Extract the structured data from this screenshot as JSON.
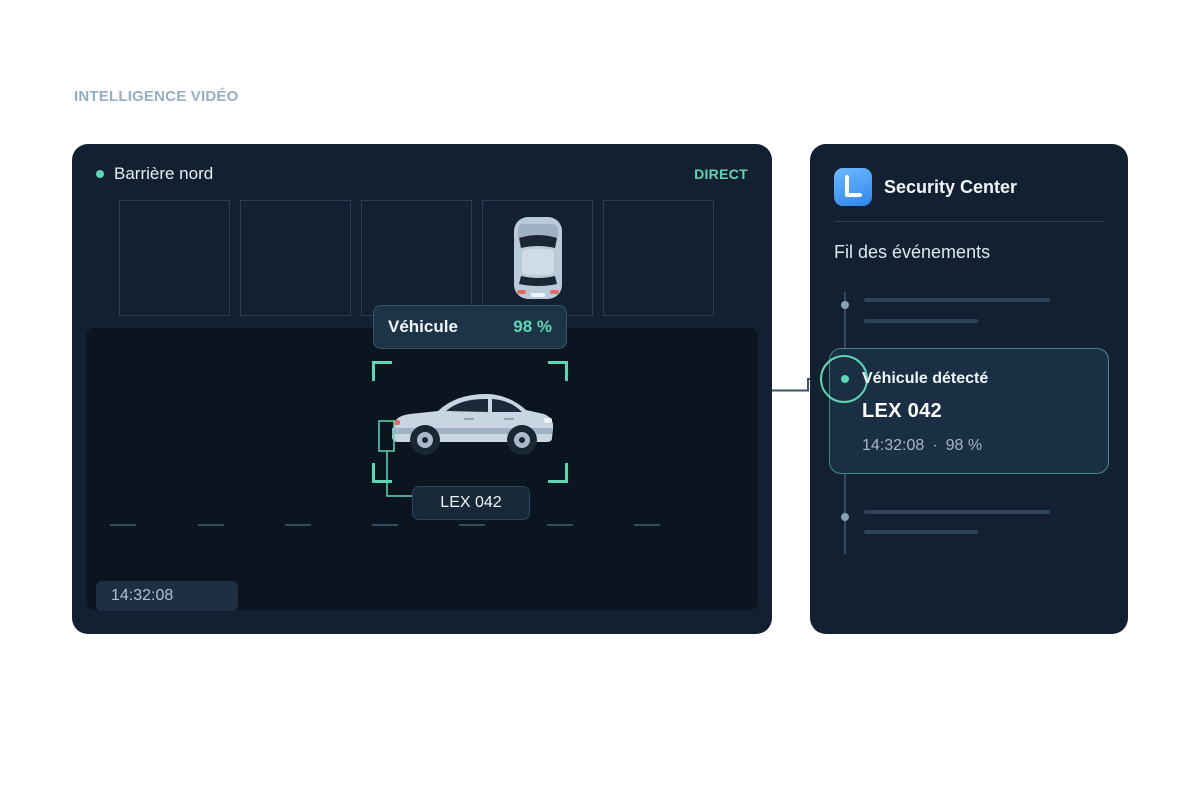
{
  "eyebrow": "INTELLIGENCE VIDÉO",
  "camera": {
    "name": "Barrière nord",
    "status": "DIRECT",
    "detection": {
      "label": "Véhicule",
      "confidence": "98 %"
    },
    "plate": "LEX 042",
    "timestamp": "14:32:08"
  },
  "app": {
    "title": "Security Center",
    "feed_title": "Fil des événements",
    "icon": "app-logo-icon",
    "event": {
      "title": "Véhicule détecté",
      "plate": "LEX 042",
      "time": "14:32:08",
      "separator": "·",
      "confidence": "98 %"
    }
  },
  "colors": {
    "accent": "#5ed6b4",
    "panel": "#122032",
    "road": "#0a1520",
    "app_icon": "#3b8ff0"
  }
}
